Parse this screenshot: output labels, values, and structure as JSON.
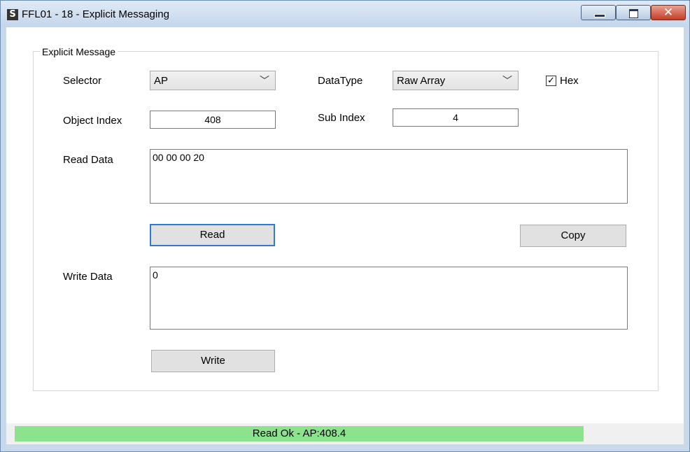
{
  "window": {
    "title": "FFL01 - 18 - Explicit Messaging",
    "app_icon_glyph": "S",
    "minimize_glyph": "",
    "maximize_glyph": "",
    "close_glyph": "✕"
  },
  "group": {
    "title": "Explicit Message"
  },
  "form": {
    "selector_label": "Selector",
    "selector_value": "AP",
    "datatype_label": "DataType",
    "datatype_value": "Raw Array",
    "hex_label": "Hex",
    "hex_checked": true,
    "object_index_label": "Object Index",
    "object_index_value": "408",
    "sub_index_label": "Sub Index",
    "sub_index_value": "4",
    "read_data_label": "Read Data",
    "read_data_value": "00 00 00 20",
    "read_button": "Read",
    "copy_button": "Copy",
    "write_data_label": "Write Data",
    "write_data_value": "0",
    "write_button": "Write"
  },
  "status": {
    "text": "Read Ok - AP:408.4",
    "progress": 1.0,
    "color": "#8de38d"
  },
  "icons": {
    "check": "✓",
    "chevron": "﹀"
  }
}
